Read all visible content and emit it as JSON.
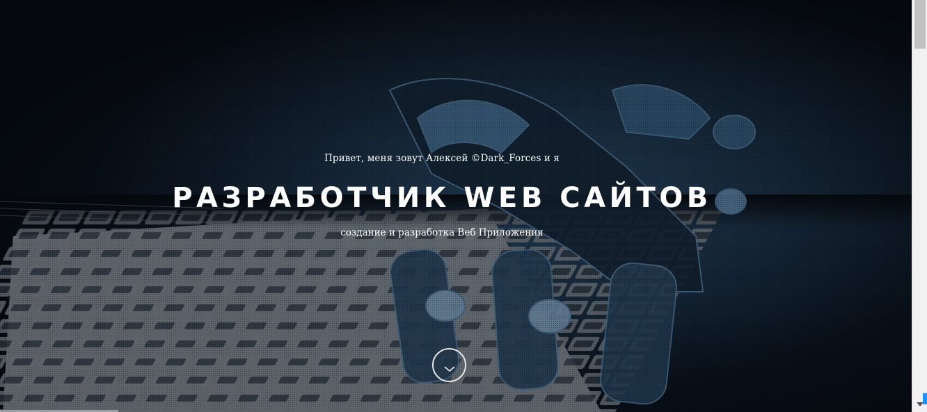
{
  "hero": {
    "greeting": "Привет, меня зовут Алексей ©Dark_Forces и я",
    "title": "РАЗРАБОТЧИК WEB САЙТОВ",
    "subtitle": "создание и разработка Веб Приложения"
  },
  "icons": {
    "scroll_down": "chevron-down-icon",
    "scrollbar_down": "triangle-down-icon"
  },
  "colors": {
    "text": "#ffffff",
    "background": "#05090d",
    "accent_blue": "#1e90ff"
  }
}
